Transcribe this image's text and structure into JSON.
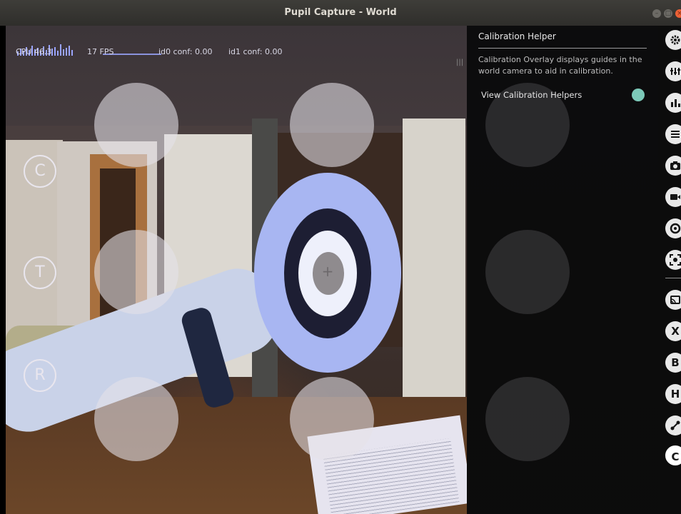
{
  "window": {
    "title": "Pupil Capture - World"
  },
  "hud": {
    "cpu": "CPU 46.3",
    "fps": "17 FPS",
    "id0": "id0 conf: 0.00",
    "id1": "id1 conf: 0.00"
  },
  "mode_buttons": [
    "C",
    "T",
    "R"
  ],
  "panel": {
    "title": "Calibration Helper",
    "description": "Calibration Overlay displays guides in the world camera to aid in calibration.",
    "toggle_label": "View Calibration Helpers",
    "toggle_on": true,
    "toggle_color": "#7cc9b8"
  },
  "sidebar": {
    "icons": [
      {
        "name": "settings-icon"
      },
      {
        "name": "capture-settings-icon"
      },
      {
        "name": "system-graphs-icon"
      },
      {
        "name": "plugin-manager-icon"
      },
      {
        "name": "world-camera-icon"
      },
      {
        "name": "recorder-icon"
      },
      {
        "name": "pupil-detector-icon"
      },
      {
        "name": "calibration-icon"
      },
      {
        "name": "screen-cast-icon"
      },
      {
        "name": "plugin-x",
        "label": "X"
      },
      {
        "name": "plugin-b",
        "label": "B"
      },
      {
        "name": "plugin-h",
        "label": "H"
      },
      {
        "name": "network-icon"
      },
      {
        "name": "plugin-c",
        "label": "C"
      }
    ]
  }
}
